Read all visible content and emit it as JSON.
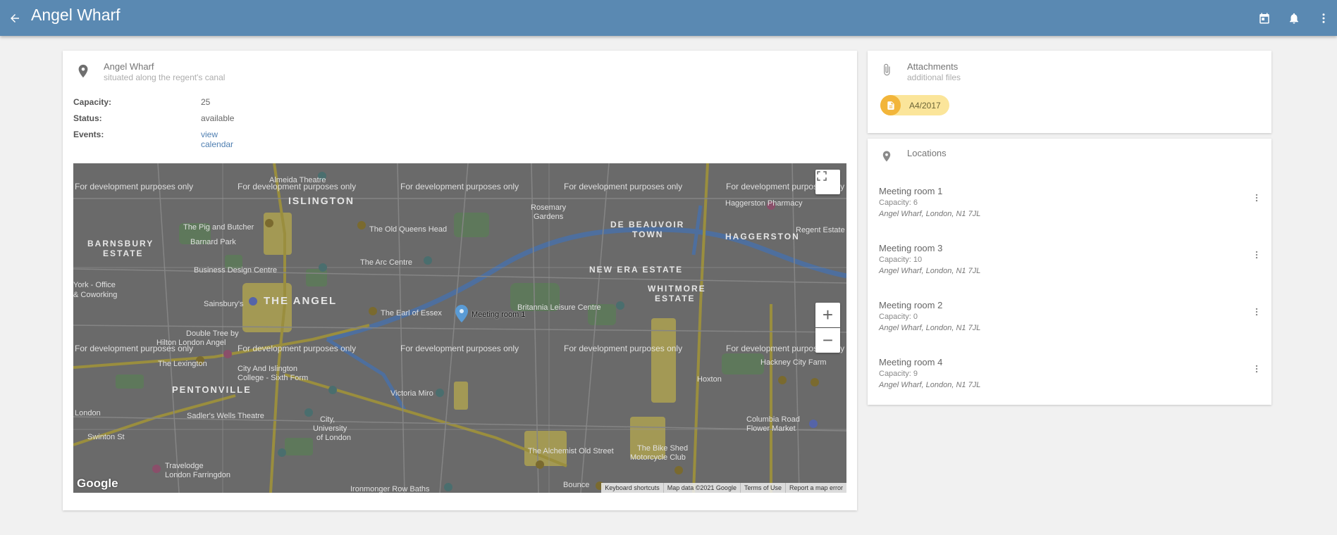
{
  "header": {
    "title": "Angel Wharf",
    "back_icon": "arrow-back-icon",
    "action_icons": [
      "calendar-icon",
      "bell-icon",
      "more-vert-icon"
    ]
  },
  "details_card": {
    "icon": "location-pin-icon",
    "title": "Angel Wharf",
    "subtitle": "situated along the regent's canal",
    "fields": [
      {
        "label": "Capacity:",
        "value": "25"
      },
      {
        "label": "Status:",
        "value": "available"
      },
      {
        "label": "Events:",
        "value": "view calendar"
      }
    ]
  },
  "map": {
    "watermark": "For development purposes only",
    "marker_label": "Meeting room 1",
    "place_labels": [
      "ISLINGTON",
      "BARNSBURY ESTATE",
      "THE ANGEL",
      "PENTONVILLE",
      "DE BEAUVOIR TOWN",
      "HAGGERSTON",
      "NEW ERA ESTATE",
      "WHITMORE ESTATE",
      "Rosemary Gardens",
      "Barnard Park",
      "Almeida Theatre",
      "The Pig and Butcher",
      "The Old Queens Head",
      "Business Design Centre",
      "The Arc Centre",
      "Sainsbury's",
      "Double Tree by Hilton London Angel",
      "The Earl of Essex",
      "Britannia Leisure Centre",
      "The Lexington",
      "City And Islington College - Sixth Form",
      "Sadler's Wells Theatre",
      "City, University of London",
      "Victoria Miro",
      "The Alchemist Old Street",
      "The Bike Shed Motorcycle Club",
      "Travelodge London Farringdon",
      "Hackney City Farm",
      "Columbia Road Flower Market",
      "Haggerston Pharmacy",
      "Regent Estate",
      "Hoxton",
      "Ironmonger Row Baths",
      "Bounce",
      "London",
      "Swinton St",
      "York - Office & Coworking"
    ],
    "logo": "Google",
    "footer": [
      "Keyboard shortcuts",
      "Map data ©2021 Google",
      "Terms of Use",
      "Report a map error"
    ],
    "zoom_in": "+",
    "zoom_out": "−"
  },
  "attachments": {
    "icon": "paperclip-icon",
    "title": "Attachments",
    "subtitle": "additional files",
    "files": [
      {
        "name": "A4/2017",
        "icon": "document-icon"
      }
    ]
  },
  "locations": {
    "icon": "location-pin-icon",
    "title": "Locations",
    "items": [
      {
        "name": "Meeting room 1",
        "capacity": "Capacity: 6",
        "address": "Angel Wharf, London, N1 7JL"
      },
      {
        "name": "Meeting room 3",
        "capacity": "Capacity: 10",
        "address": "Angel Wharf, London, N1 7JL"
      },
      {
        "name": "Meeting room 2",
        "capacity": "Capacity: 0",
        "address": "Angel Wharf, London, N1 7JL"
      },
      {
        "name": "Meeting room 4",
        "capacity": "Capacity: 9",
        "address": "Angel Wharf, London, N1 7JL"
      }
    ]
  },
  "colors": {
    "header_bg": "#5a89b2",
    "link": "#4f7fb1",
    "chip_bg": "#fbe59a",
    "chip_icon_bg": "#f2b53a",
    "map_marker": "#5a9bd5"
  }
}
